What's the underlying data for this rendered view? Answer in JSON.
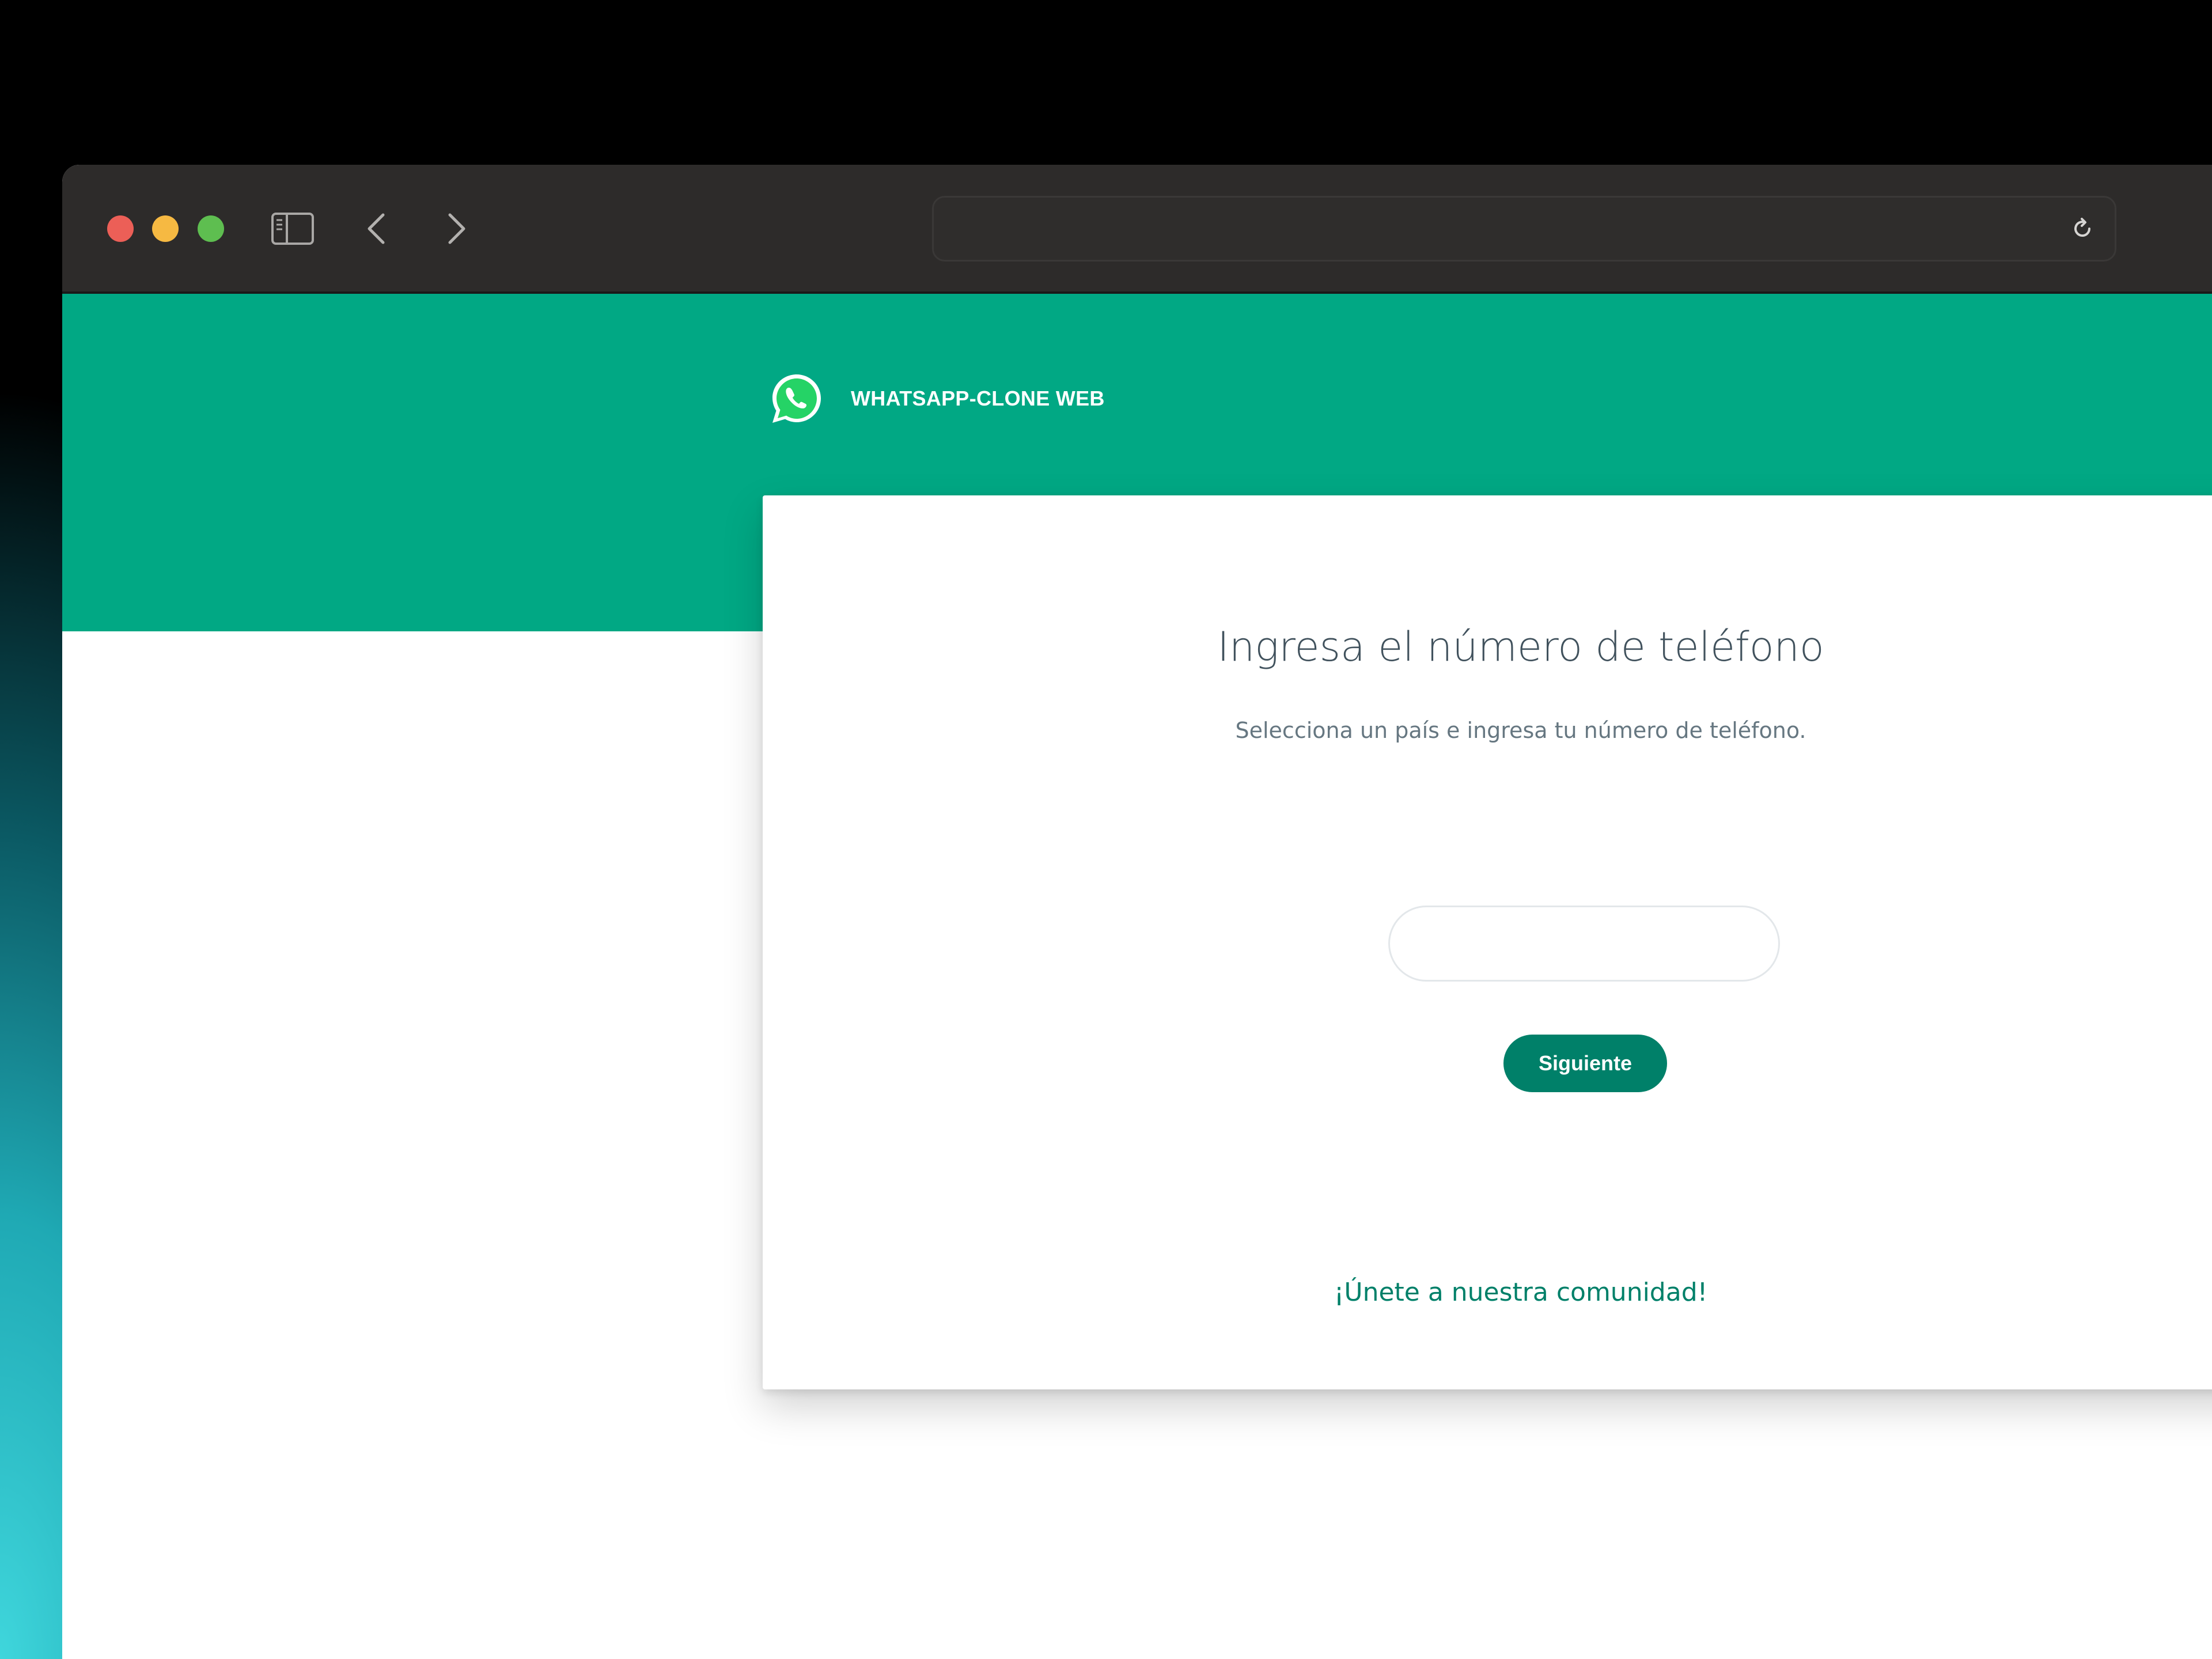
{
  "browser": {
    "address_text": "",
    "icons": {
      "sidebar": "sidebar-icon",
      "back": "chevron-left-icon",
      "forward": "chevron-right-icon",
      "reload": "reload-icon"
    },
    "traffic_lights": {
      "close_color": "#ec5f57",
      "minimize_color": "#f6b942",
      "zoom_color": "#5ebe50"
    }
  },
  "header": {
    "brand_title": "WHATSAPP-CLONE WEB",
    "logo_icon": "whatsapp-logo-icon",
    "band_color": "#01a884"
  },
  "login": {
    "title": "Ingresa el número de teléfono",
    "subtitle": "Selecciona un país e ingresa tu número de teléfono.",
    "phone_value": "",
    "next_label": "Siguiente",
    "community_link": "¡Únete a nuestra comunidad!",
    "accent_color": "#008069"
  }
}
